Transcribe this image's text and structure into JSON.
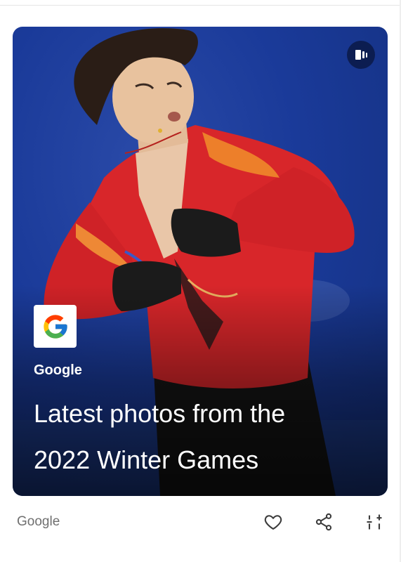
{
  "card": {
    "story_icon": "web-story-icon",
    "logo_icon": "google-g-logo",
    "publisher": "Google",
    "headline_line1": "Latest photos from the",
    "headline_line2": "2022 Winter Games"
  },
  "footer": {
    "source": "Google",
    "actions": [
      {
        "icon": "heart-icon"
      },
      {
        "icon": "share-icon"
      },
      {
        "icon": "tune-icon"
      }
    ]
  },
  "colors": {
    "background_blue": "#1a3a99",
    "costume_red": "#d8262a",
    "text_grey": "#6f6f6f"
  }
}
